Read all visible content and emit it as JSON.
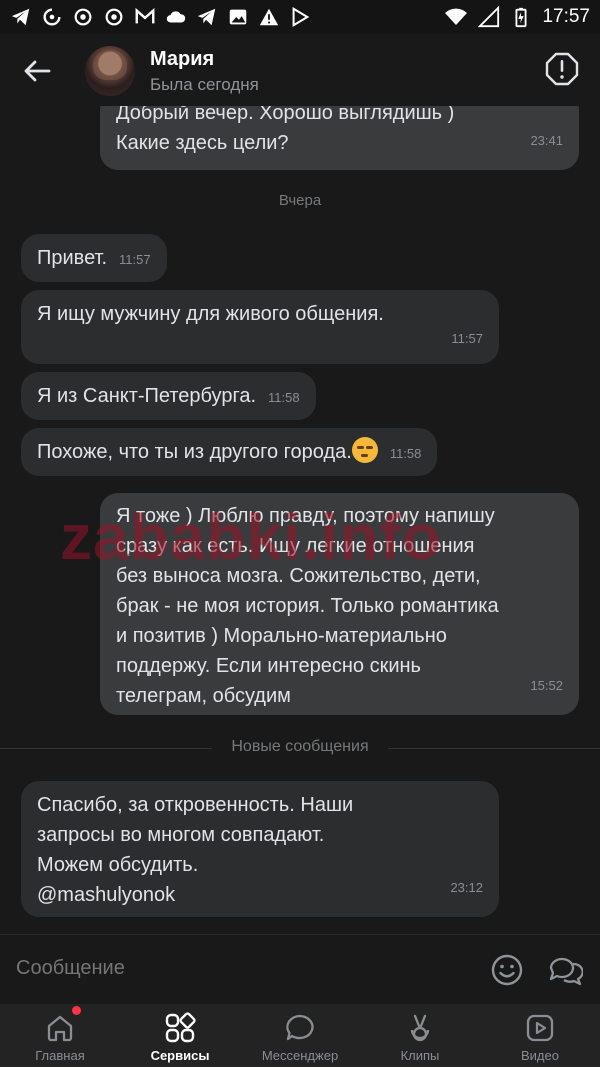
{
  "status_bar": {
    "time": "17:57"
  },
  "header": {
    "name": "Мария",
    "status": "Была сегодня"
  },
  "messages": {
    "m1": {
      "text1": "Добрый вечер. Хорошо выглядишь )",
      "text2": "Какие здесь цели?",
      "time": "23:41"
    },
    "date_divider": "Вчера",
    "m2": {
      "text": "Привет.",
      "time": "11:57"
    },
    "m3": {
      "text": "Я ищу мужчину для живого общения.",
      "time": "11:57"
    },
    "m4": {
      "text": "Я из Санкт-Петербурга.",
      "time": "11:58"
    },
    "m5": {
      "text": "Похоже, что ты из другого города.",
      "time": "11:58"
    },
    "m6": {
      "lines": [
        "Я тоже ) Люблю правду, поэтому напишу",
        "сразу как есть. Ищу легкие отношения",
        "без выноса мозга. Сожительство, дети,",
        "брак - не моя история. Только романтика",
        "и позитив ) Морально-материально",
        "поддержу. Если интересно скинь",
        "телеграм, обсудим"
      ],
      "time": "15:52"
    },
    "new_divider": "Новые сообщения",
    "m7": {
      "lines": [
        "Спасибо, за откровенность. Наши",
        "запросы во многом совпадают.",
        "Можем обсудить.",
        "@mashulyonok"
      ],
      "time": "23:12"
    }
  },
  "watermark": "zababki.info",
  "composer": {
    "placeholder": "Сообщение"
  },
  "tabs": [
    {
      "label": "Главная",
      "icon": "home-icon"
    },
    {
      "label": "Сервисы",
      "icon": "services-icon"
    },
    {
      "label": "Мессенджер",
      "icon": "messenger-icon"
    },
    {
      "label": "Клипы",
      "icon": "clips-icon"
    },
    {
      "label": "Видео",
      "icon": "video-icon"
    }
  ],
  "colors": {
    "background": "#191919",
    "incoming_bubble": "#2c2d2e",
    "outgoing_bubble": "#3a3b3c",
    "badge": "#ff3347"
  }
}
